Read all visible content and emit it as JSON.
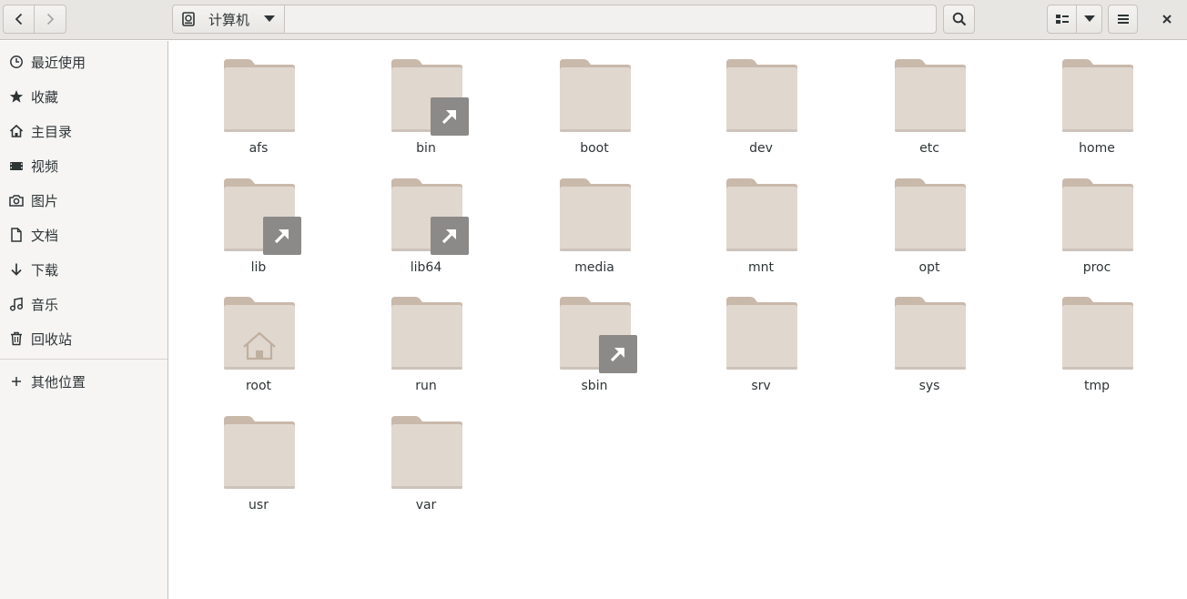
{
  "header": {
    "location_label": "计算机",
    "back_icon": "chevron-left-icon",
    "forward_icon": "chevron-right-icon",
    "search_icon": "search-icon",
    "view_icon": "list-view-icon",
    "menu_icon": "hamburger-menu-icon",
    "close_icon": "close-icon"
  },
  "sidebar": {
    "items": [
      {
        "label": "最近使用",
        "icon": "clock-icon"
      },
      {
        "label": "收藏",
        "icon": "star-icon"
      },
      {
        "label": "主目录",
        "icon": "home-icon"
      },
      {
        "label": "视频",
        "icon": "video-icon"
      },
      {
        "label": "图片",
        "icon": "camera-icon"
      },
      {
        "label": "文档",
        "icon": "document-icon"
      },
      {
        "label": "下载",
        "icon": "download-icon"
      },
      {
        "label": "音乐",
        "icon": "music-icon"
      },
      {
        "label": "回收站",
        "icon": "trash-icon"
      }
    ],
    "other_locations": {
      "label": "其他位置",
      "icon": "plus-icon"
    }
  },
  "folders": [
    {
      "name": "afs",
      "link": false,
      "home": false
    },
    {
      "name": "bin",
      "link": true,
      "home": false
    },
    {
      "name": "boot",
      "link": false,
      "home": false
    },
    {
      "name": "dev",
      "link": false,
      "home": false
    },
    {
      "name": "etc",
      "link": false,
      "home": false
    },
    {
      "name": "home",
      "link": false,
      "home": false
    },
    {
      "name": "lib",
      "link": true,
      "home": false
    },
    {
      "name": "lib64",
      "link": true,
      "home": false
    },
    {
      "name": "media",
      "link": false,
      "home": false
    },
    {
      "name": "mnt",
      "link": false,
      "home": false
    },
    {
      "name": "opt",
      "link": false,
      "home": false
    },
    {
      "name": "proc",
      "link": false,
      "home": false
    },
    {
      "name": "root",
      "link": false,
      "home": true
    },
    {
      "name": "run",
      "link": false,
      "home": false
    },
    {
      "name": "sbin",
      "link": true,
      "home": false
    },
    {
      "name": "srv",
      "link": false,
      "home": false
    },
    {
      "name": "sys",
      "link": false,
      "home": false
    },
    {
      "name": "tmp",
      "link": false,
      "home": false
    },
    {
      "name": "usr",
      "link": false,
      "home": false
    },
    {
      "name": "var",
      "link": false,
      "home": false
    }
  ],
  "colors": {
    "folder_back": "#c9b9ab",
    "folder_front": "#e0d7cf",
    "link_badge": "#8c8a88"
  }
}
